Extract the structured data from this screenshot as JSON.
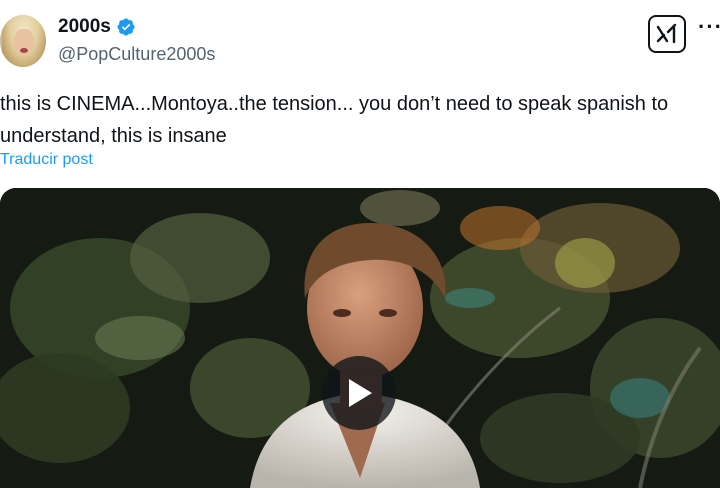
{
  "post": {
    "author": {
      "display_name": "2000s",
      "handle": "@PopCulture2000s",
      "verified": true,
      "avatar_icon": "profile-photo"
    },
    "text": "this is CINEMA...Montoya..the tension... you don’t need to speak spanish to understand, this is insane",
    "translate_label": "Traducir post",
    "actions": {
      "grok_icon": "grok-icon",
      "more_icon": "more-options-icon",
      "more_label": "···"
    },
    "media": {
      "type": "video",
      "play_icon": "play-icon"
    }
  },
  "colors": {
    "accent": "#1d9bf0",
    "text": "#0f1419",
    "secondary": "#536471",
    "verified": "#1d9bf0"
  }
}
